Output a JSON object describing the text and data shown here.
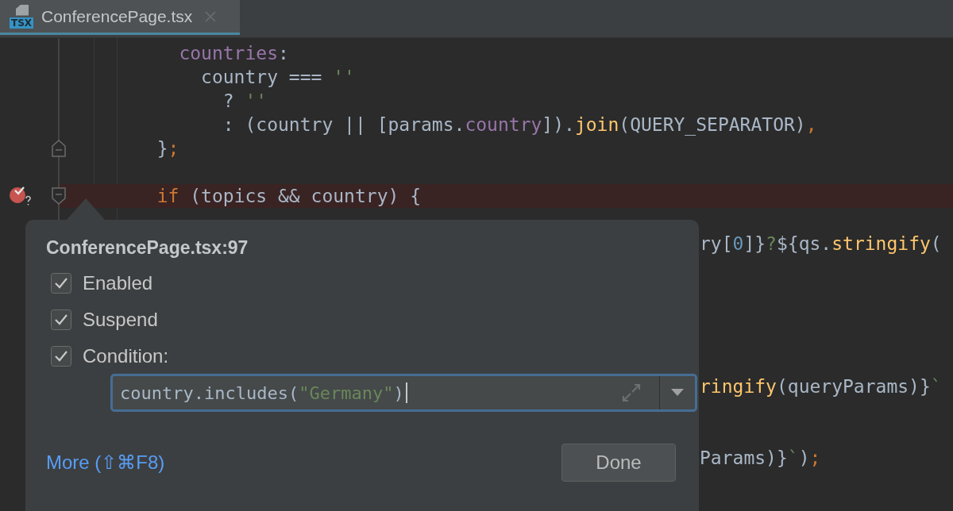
{
  "tab": {
    "title": "ConferencePage.tsx",
    "icon_label": "TSX",
    "selected": true
  },
  "code_lines": [
    {
      "kind": "line",
      "tokens": [
        {
          "t": "countries",
          "kind": "prop"
        },
        {
          "t": ":",
          "kind": "plain"
        }
      ]
    },
    {
      "kind": "line",
      "tokens": [
        {
          "t": "country === ",
          "kind": "plain"
        },
        {
          "t": "''",
          "kind": "string"
        }
      ]
    },
    {
      "kind": "line",
      "tokens": [
        {
          "t": "? ",
          "kind": "plain"
        },
        {
          "t": "''",
          "kind": "string"
        }
      ]
    },
    {
      "kind": "line",
      "tokens": [
        {
          "t": ": (country || [params.",
          "kind": "plain"
        },
        {
          "t": "country",
          "kind": "prop"
        },
        {
          "t": "]).",
          "kind": "plain"
        },
        {
          "t": "join",
          "kind": "func"
        },
        {
          "t": "(QUERY_SEPARATOR)",
          "kind": "plain"
        },
        {
          "t": ",",
          "kind": "keyword"
        }
      ]
    },
    {
      "kind": "line",
      "fold_end": true,
      "tokens": [
        {
          "t": "}",
          "kind": "plain"
        },
        {
          "t": ";",
          "kind": "keyword"
        }
      ]
    },
    {
      "kind": "blank"
    },
    {
      "kind": "line",
      "fold_start": true,
      "breakpoint": true,
      "tokens": [
        {
          "t": "if",
          "kind": "keyword"
        },
        {
          "t": " (topics && country) {",
          "kind": "plain"
        }
      ]
    },
    {
      "kind": "blank"
    },
    {
      "kind": "fragment",
      "tokens": [
        {
          "t": "ry[",
          "kind": "plain"
        },
        {
          "t": "0",
          "kind": "num"
        },
        {
          "t": "]}",
          "kind": "plain"
        },
        {
          "t": "?",
          "kind": "string"
        },
        {
          "t": "${qs.",
          "kind": "plain"
        },
        {
          "t": "stringify",
          "kind": "func"
        },
        {
          "t": "(",
          "kind": "plain"
        }
      ]
    },
    {
      "kind": "blank"
    },
    {
      "kind": "blank"
    },
    {
      "kind": "blank"
    },
    {
      "kind": "blank"
    },
    {
      "kind": "blank"
    },
    {
      "kind": "fragment",
      "tokens": [
        {
          "t": "ringify",
          "kind": "func"
        },
        {
          "t": "(queryParams)}",
          "kind": "plain"
        },
        {
          "t": "`",
          "kind": "string"
        }
      ]
    },
    {
      "kind": "blank"
    },
    {
      "kind": "blank"
    },
    {
      "kind": "fragment",
      "tokens": [
        {
          "t": "Params)}",
          "kind": "plain"
        },
        {
          "t": "`",
          "kind": "string"
        },
        {
          "t": ")",
          "kind": "plain"
        },
        {
          "t": ";",
          "kind": "keyword"
        }
      ]
    }
  ],
  "popup": {
    "title": "ConferencePage.tsx:97",
    "options": [
      {
        "label": "Enabled",
        "checked": true
      },
      {
        "label": "Suspend",
        "checked": true
      },
      {
        "label": "Condition:",
        "checked": true
      }
    ],
    "condition": {
      "tokens": [
        {
          "t": "country.includes(",
          "kind": "plain"
        },
        {
          "t": "\"Germany\"",
          "kind": "string"
        },
        {
          "t": ")",
          "kind": "plain"
        }
      ]
    },
    "more_link": "More (⇧⌘F8)",
    "done_button": "Done"
  }
}
